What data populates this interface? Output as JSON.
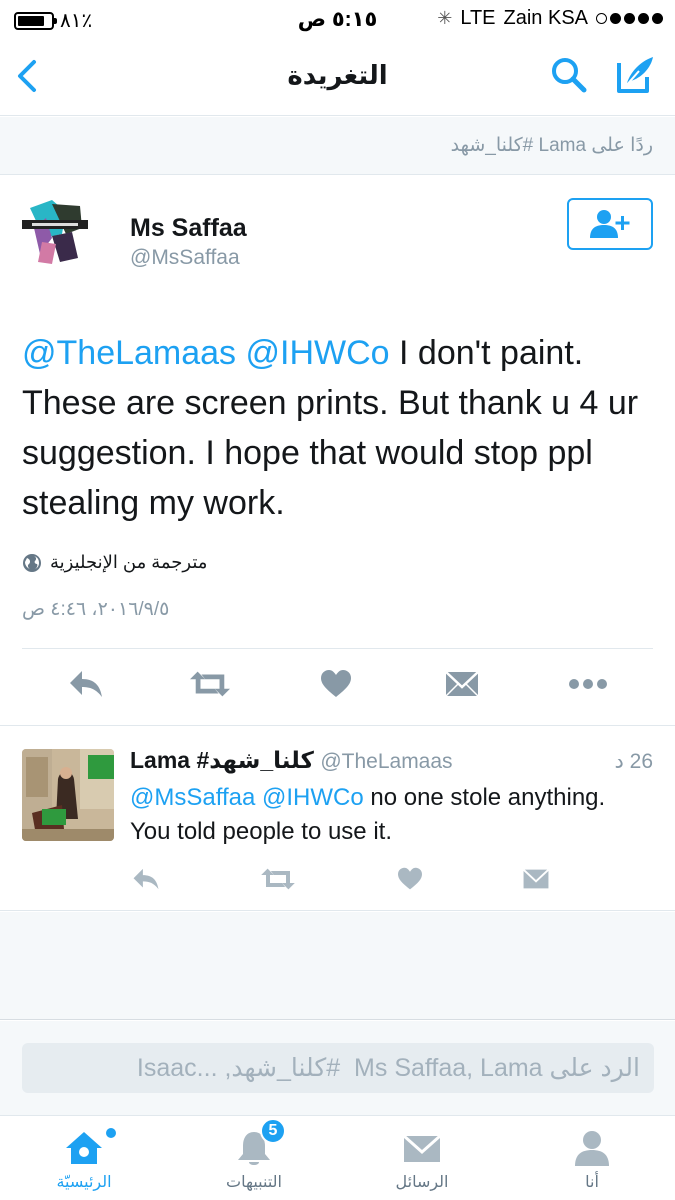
{
  "status_bar": {
    "battery_text": "٨١٪",
    "battery_level": 0.81,
    "time": "٥:١٥ ص",
    "network": "LTE",
    "carrier": "Zain KSA",
    "signal_bars_filled": 4
  },
  "navbar": {
    "title": "التغريدة",
    "back_icon": "chevron-left-icon",
    "search_icon": "search-icon",
    "compose_icon": "compose-icon"
  },
  "context": {
    "text": "ردًا على  Lama  #كلنا_شهد"
  },
  "main_tweet": {
    "author_name": "Ms Saffaa",
    "author_handle": "@MsSaffaa",
    "mention_1": "@TheLamaas",
    "mention_2": "@IHWCo",
    "body": " I don't paint. These are screen prints. But thank u 4 ur suggestion. I hope that would stop ppl stealing my work.",
    "translated_label": "مترجمة من الإنجليزية",
    "timestamp": "٢٠١٦/٩/٥، ٤:٤٦ ص"
  },
  "reply_tweet": {
    "author_name": "Lama #كلنا_شهد",
    "author_handle": "@TheLamaas",
    "time": "26 د",
    "mention_1": "@MsSaffaa",
    "mention_2": "@IHWCo",
    "body": " no one stole anything. You told people to use it."
  },
  "composer": {
    "placeholder": "الرد على Ms Saffaa, Lama  #كلنا_شهد, ...Isaac"
  },
  "tabs": [
    {
      "label": "الرئيسيّة",
      "icon": "home-icon",
      "active": true
    },
    {
      "label": "التنبيهات",
      "icon": "bell-icon",
      "badge": "5"
    },
    {
      "label": "الرسائل",
      "icon": "envelope-icon"
    },
    {
      "label": "أنا",
      "icon": "person-icon"
    }
  ],
  "colors": {
    "accent": "#1da1f2",
    "muted": "#8899a6",
    "icon_gray": "#8899a6",
    "background_light": "#f5f8fa"
  }
}
